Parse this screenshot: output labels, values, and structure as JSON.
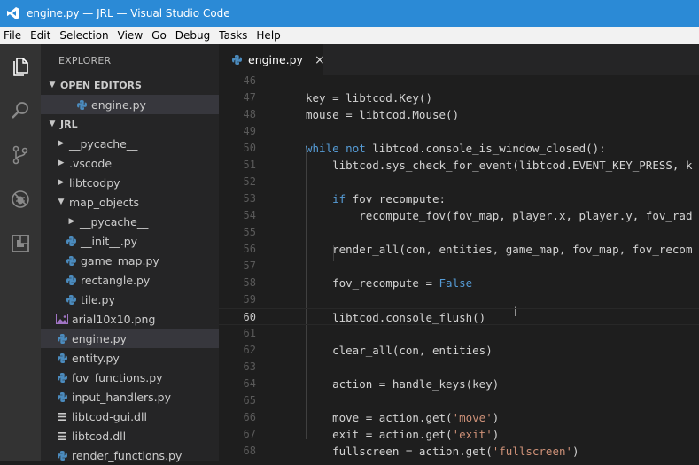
{
  "window": {
    "title": "engine.py — JRL — Visual Studio Code"
  },
  "menu": [
    "File",
    "Edit",
    "Selection",
    "View",
    "Go",
    "Debug",
    "Tasks",
    "Help"
  ],
  "activity": [
    "files-icon",
    "search-icon",
    "source-control-icon",
    "debug-icon",
    "extensions-icon"
  ],
  "sidebar": {
    "title": "EXPLORER",
    "open_editors_label": "OPEN EDITORS",
    "open_editors": [
      {
        "name": "engine.py"
      }
    ],
    "project_label": "JRL",
    "tree": [
      {
        "name": "__pycache__",
        "type": "folder",
        "depth": 1,
        "expanded": false
      },
      {
        "name": ".vscode",
        "type": "folder",
        "depth": 1,
        "expanded": false
      },
      {
        "name": "libtcodpy",
        "type": "folder",
        "depth": 1,
        "expanded": false
      },
      {
        "name": "map_objects",
        "type": "folder",
        "depth": 1,
        "expanded": true
      },
      {
        "name": "__pycache__",
        "type": "folder",
        "depth": 2,
        "expanded": false
      },
      {
        "name": "__init__.py",
        "type": "python",
        "depth": 2
      },
      {
        "name": "game_map.py",
        "type": "python",
        "depth": 2
      },
      {
        "name": "rectangle.py",
        "type": "python",
        "depth": 2
      },
      {
        "name": "tile.py",
        "type": "python",
        "depth": 2
      },
      {
        "name": "arial10x10.png",
        "type": "image",
        "depth": 1
      },
      {
        "name": "engine.py",
        "type": "python",
        "depth": 1,
        "selected": true
      },
      {
        "name": "entity.py",
        "type": "python",
        "depth": 1
      },
      {
        "name": "fov_functions.py",
        "type": "python",
        "depth": 1
      },
      {
        "name": "input_handlers.py",
        "type": "python",
        "depth": 1
      },
      {
        "name": "libtcod-gui.dll",
        "type": "dll",
        "depth": 1
      },
      {
        "name": "libtcod.dll",
        "type": "dll",
        "depth": 1
      },
      {
        "name": "render_functions.py",
        "type": "python",
        "depth": 1
      }
    ]
  },
  "editor": {
    "tab": {
      "label": "engine.py",
      "close": "×"
    },
    "lines": [
      {
        "n": "46",
        "t": ""
      },
      {
        "n": "47",
        "t": "    key = libtcod.Key()"
      },
      {
        "n": "48",
        "t": "    mouse = libtcod.Mouse()"
      },
      {
        "n": "49",
        "t": ""
      },
      {
        "n": "50",
        "t": "    while not libtcod.console_is_window_closed():"
      },
      {
        "n": "51",
        "t": "        libtcod.sys_check_for_event(libtcod.EVENT_KEY_PRESS, k"
      },
      {
        "n": "52",
        "t": ""
      },
      {
        "n": "53",
        "t": "        if fov_recompute:"
      },
      {
        "n": "54",
        "t": "            recompute_fov(fov_map, player.x, player.y, fov_rad"
      },
      {
        "n": "55",
        "t": ""
      },
      {
        "n": "56",
        "t": "        render_all(con, entities, game_map, fov_map, fov_recom"
      },
      {
        "n": "57",
        "t": ""
      },
      {
        "n": "58",
        "t": "        fov_recompute = False"
      },
      {
        "n": "59",
        "t": ""
      },
      {
        "n": "60",
        "t": "        libtcod.console_flush()"
      },
      {
        "n": "61",
        "t": ""
      },
      {
        "n": "62",
        "t": "        clear_all(con, entities)"
      },
      {
        "n": "63",
        "t": ""
      },
      {
        "n": "64",
        "t": "        action = handle_keys(key)"
      },
      {
        "n": "65",
        "t": ""
      },
      {
        "n": "66",
        "t": "        move = action.get('move')"
      },
      {
        "n": "67",
        "t": "        exit = action.get('exit')"
      },
      {
        "n": "68",
        "t": "        fullscreen = action.get('fullscreen')"
      }
    ],
    "current_line": "60",
    "cursor_glyph": "I"
  },
  "colors": {
    "title_bar": "#2b8ad6",
    "keyword": "#569cd6",
    "string": "#ce9178",
    "text": "#d4d4d4",
    "python_icon": "#4b8bbe"
  }
}
